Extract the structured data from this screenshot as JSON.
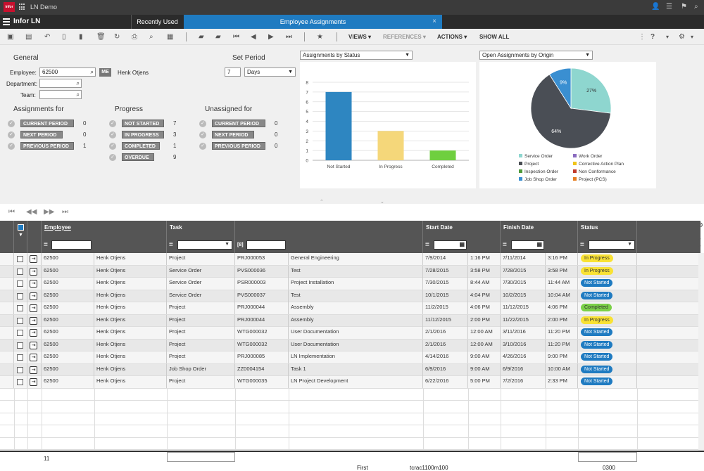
{
  "app": {
    "title": "LN Demo",
    "brand": "Infor LN",
    "logo_text": "infor"
  },
  "tabs": [
    {
      "label": "Recently Used"
    },
    {
      "label": "Employee Assignments",
      "close": "×"
    }
  ],
  "toolbar": {
    "views": "VIEWS",
    "references": "REFERENCES",
    "actions": "ACTIONS",
    "show_all": "SHOW ALL",
    "help": "?"
  },
  "general": {
    "title": "General",
    "employee_label": "Employee:",
    "employee_value": "62500",
    "me_button": "ME",
    "employee_name": "Henk Otjens",
    "department_label": "Department:",
    "team_label": "Team:"
  },
  "set_period": {
    "title": "Set Period",
    "value": "7",
    "unit": "Days"
  },
  "assignments_for": {
    "title": "Assignments for",
    "items": [
      {
        "label": "CURRENT PERIOD",
        "count": "0"
      },
      {
        "label": "NEXT PERIOD",
        "count": "0"
      },
      {
        "label": "PREVIOUS PERIOD",
        "count": "1"
      }
    ]
  },
  "progress": {
    "title": "Progress",
    "items": [
      {
        "label": "NOT STARTED",
        "count": "7"
      },
      {
        "label": "IN PROGRESS",
        "count": "3"
      },
      {
        "label": "COMPLETED",
        "count": "1"
      },
      {
        "label": "OVERDUE",
        "count": "9"
      }
    ]
  },
  "unassigned_for": {
    "title": "Unassigned for",
    "items": [
      {
        "label": "CURRENT PERIOD",
        "count": "0"
      },
      {
        "label": "NEXT PERIOD",
        "count": "0"
      },
      {
        "label": "PREVIOUS PERIOD",
        "count": "0"
      }
    ]
  },
  "chart_data": [
    {
      "type": "bar",
      "selector": "Assignments by Status",
      "categories": [
        "Not Started",
        "In Progress",
        "Completed"
      ],
      "values": [
        7,
        3,
        1
      ],
      "ylim": [
        0,
        8
      ],
      "yticks": [
        "8",
        "7",
        "6",
        "5",
        "4",
        "3",
        "2",
        "1",
        "0"
      ],
      "colors": [
        "#2e86c1",
        "#f5d77a",
        "#6fcf3f"
      ],
      "grid": true
    },
    {
      "type": "pie",
      "selector": "Open Assignments by Origin",
      "slices": [
        {
          "label": "Service Order",
          "value": 27,
          "text": "27%",
          "color": "#8ed6cf"
        },
        {
          "label": "Project",
          "value": 64,
          "text": "64%",
          "color": "#4a4e55"
        },
        {
          "label": "Job Shop Order",
          "value": 9,
          "text": "9%",
          "color": "#3a8fd1"
        }
      ],
      "legend": [
        {
          "label": "Service Order",
          "color": "#8ed6cf"
        },
        {
          "label": "Work Order",
          "color": "#8a6bbf"
        },
        {
          "label": "Project",
          "color": "#4a4e55"
        },
        {
          "label": "Corrective Action Plan",
          "color": "#f0c419"
        },
        {
          "label": "Inspection Order",
          "color": "#4e9a3a"
        },
        {
          "label": "Non Conformance",
          "color": "#c0392b"
        },
        {
          "label": "Job Shop Order",
          "color": "#3a8fd1"
        },
        {
          "label": "Project (PCS)",
          "color": "#e67e22"
        }
      ],
      "legend_position": "bottom"
    }
  ],
  "table": {
    "columns": {
      "employee": "Employee",
      "task": "Task",
      "start": "Start Date",
      "finish": "Finish Date",
      "status": "Status",
      "task_filter_prefix": "[8]"
    },
    "rows": [
      [
        "62500",
        "Henk Otjens",
        "Project",
        "PRJ000053",
        "General Engineering",
        "7/9/2014",
        "1:16 PM",
        "7/11/2014",
        "3:16 PM",
        "In Progress"
      ],
      [
        "62500",
        "Henk Otjens",
        "Service Order",
        "PVS000036",
        "Test",
        "7/28/2015",
        "3:58 PM",
        "7/28/2015",
        "3:58 PM",
        "In Progress"
      ],
      [
        "62500",
        "Henk Otjens",
        "Service Order",
        "PSR000003",
        "Project Installation",
        "7/30/2015",
        "8:44 AM",
        "7/30/2015",
        "11:44 AM",
        "Not Started"
      ],
      [
        "62500",
        "Henk Otjens",
        "Service Order",
        "PVS000037",
        "Test",
        "10/1/2015",
        "4:04 PM",
        "10/2/2015",
        "10:04 AM",
        "Not Started"
      ],
      [
        "62500",
        "Henk Otjens",
        "Project",
        "PRJ000044",
        "Assembly",
        "11/2/2015",
        "4:06 PM",
        "11/12/2015",
        "4:06 PM",
        "Completed"
      ],
      [
        "62500",
        "Henk Otjens",
        "Project",
        "PRJ000044",
        "Assembly",
        "11/12/2015",
        "2:00 PM",
        "11/22/2015",
        "2:00 PM",
        "In Progress"
      ],
      [
        "62500",
        "Henk Otjens",
        "Project",
        "WTG000032",
        "User Documentation",
        "2/1/2016",
        "12:00 AM",
        "3/11/2016",
        "11:20 PM",
        "Not Started"
      ],
      [
        "62500",
        "Henk Otjens",
        "Project",
        "WTG000032",
        "User Documentation",
        "2/1/2016",
        "12:00 AM",
        "3/10/2016",
        "11:20 PM",
        "Not Started"
      ],
      [
        "62500",
        "Henk Otjens",
        "Project",
        "PRJ000085",
        "LN Implementation",
        "4/14/2016",
        "9:00 AM",
        "4/26/2016",
        "9:00 PM",
        "Not Started"
      ],
      [
        "62500",
        "Henk Otjens",
        "Job Shop Order",
        "ZZ0004154",
        "Task 1",
        "6/9/2016",
        "9:00 AM",
        "6/9/2016",
        "10:00 AM",
        "Not Started"
      ],
      [
        "62500",
        "Henk Otjens",
        "Project",
        "WTG000035",
        "LN Project Development",
        "6/22/2016",
        "5:00 PM",
        "7/2/2016",
        "2:33 PM",
        "Not Started"
      ]
    ],
    "row_count": "11"
  },
  "footer": {
    "first": "First",
    "session": "tcrac1100m100",
    "code": "0300"
  }
}
